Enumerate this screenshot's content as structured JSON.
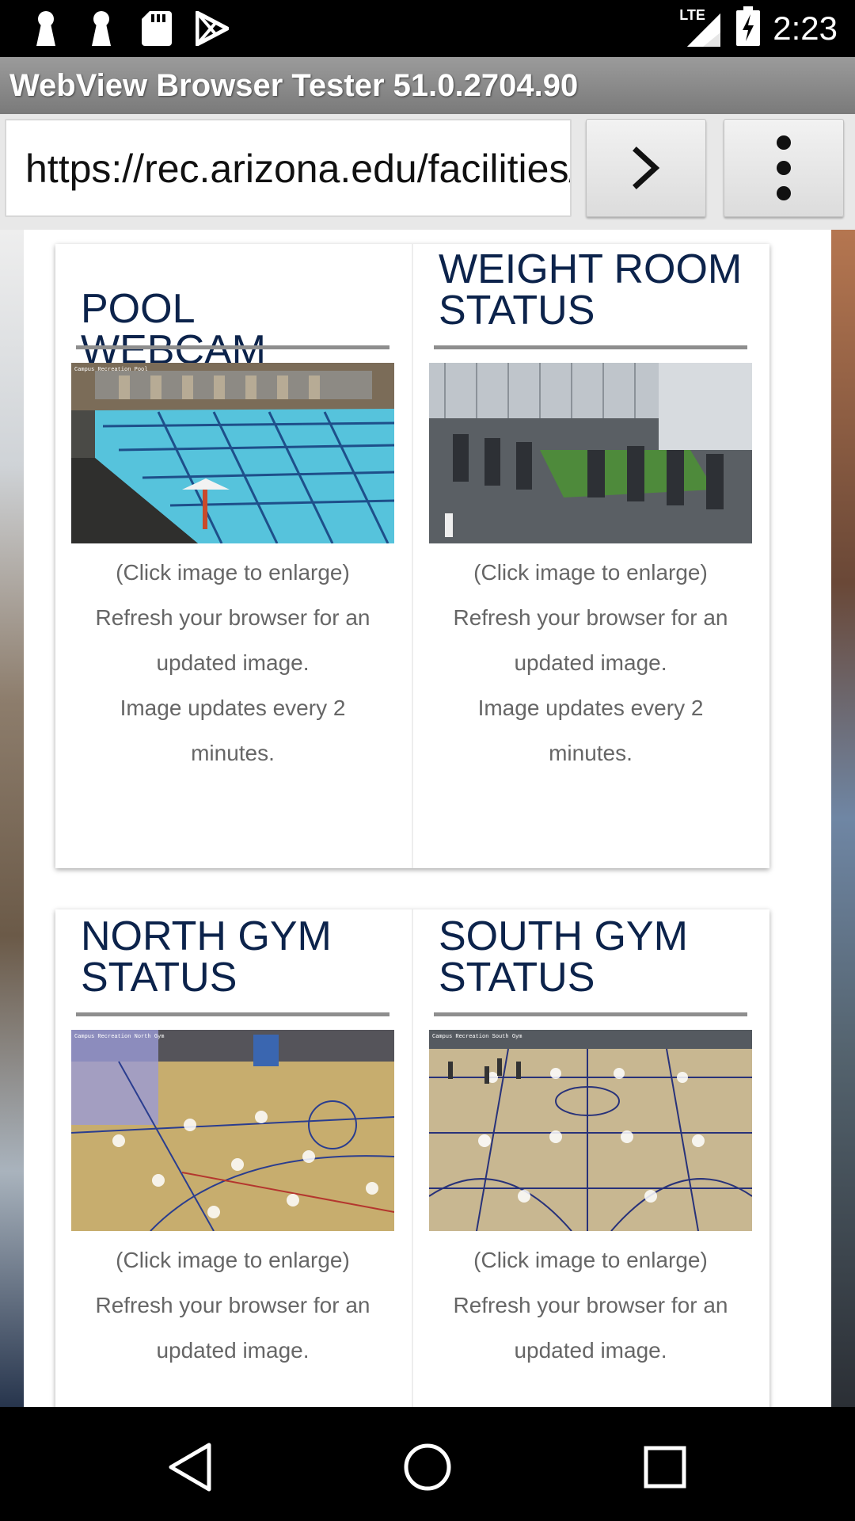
{
  "status_bar": {
    "time": "2:23",
    "network": "LTE",
    "left_icons": [
      "keyhole-icon",
      "keyhole-icon",
      "sd-card-icon",
      "play-store-icon"
    ]
  },
  "app": {
    "title": "WebView Browser Tester 51.0.2704.90"
  },
  "toolbar": {
    "url": "https://rec.arizona.edu/facilities/webcams",
    "go_icon": "chevron-right-icon",
    "menu_icon": "more-vert-icon"
  },
  "tiles": [
    {
      "title": "POOL WEBCAM",
      "image_label": "Campus Recreation Pool",
      "lines": [
        "(Click image to enlarge)",
        "Refresh your browser for an",
        "updated image.",
        "Image updates every 2",
        "minutes."
      ]
    },
    {
      "title": "WEIGHT ROOM STATUS",
      "image_label": "",
      "lines": [
        "(Click image to enlarge)",
        "Refresh your browser for an",
        "updated image.",
        "Image updates every 2",
        "minutes."
      ]
    },
    {
      "title": "NORTH GYM STATUS",
      "image_label": "Campus Recreation North Gym",
      "lines": [
        "(Click image to enlarge)",
        "Refresh your browser for an",
        "updated image."
      ]
    },
    {
      "title": "SOUTH GYM STATUS",
      "image_label": "Campus Recreation South Gym",
      "lines": [
        "(Click image to enlarge)",
        "Refresh your browser for an",
        "updated image."
      ]
    }
  ],
  "colors": {
    "heading": "#0c234b",
    "body_text": "#666666",
    "rule": "#8e8e8e"
  },
  "nav_bar": {
    "icons": [
      "back-icon",
      "home-icon",
      "recents-icon"
    ]
  }
}
